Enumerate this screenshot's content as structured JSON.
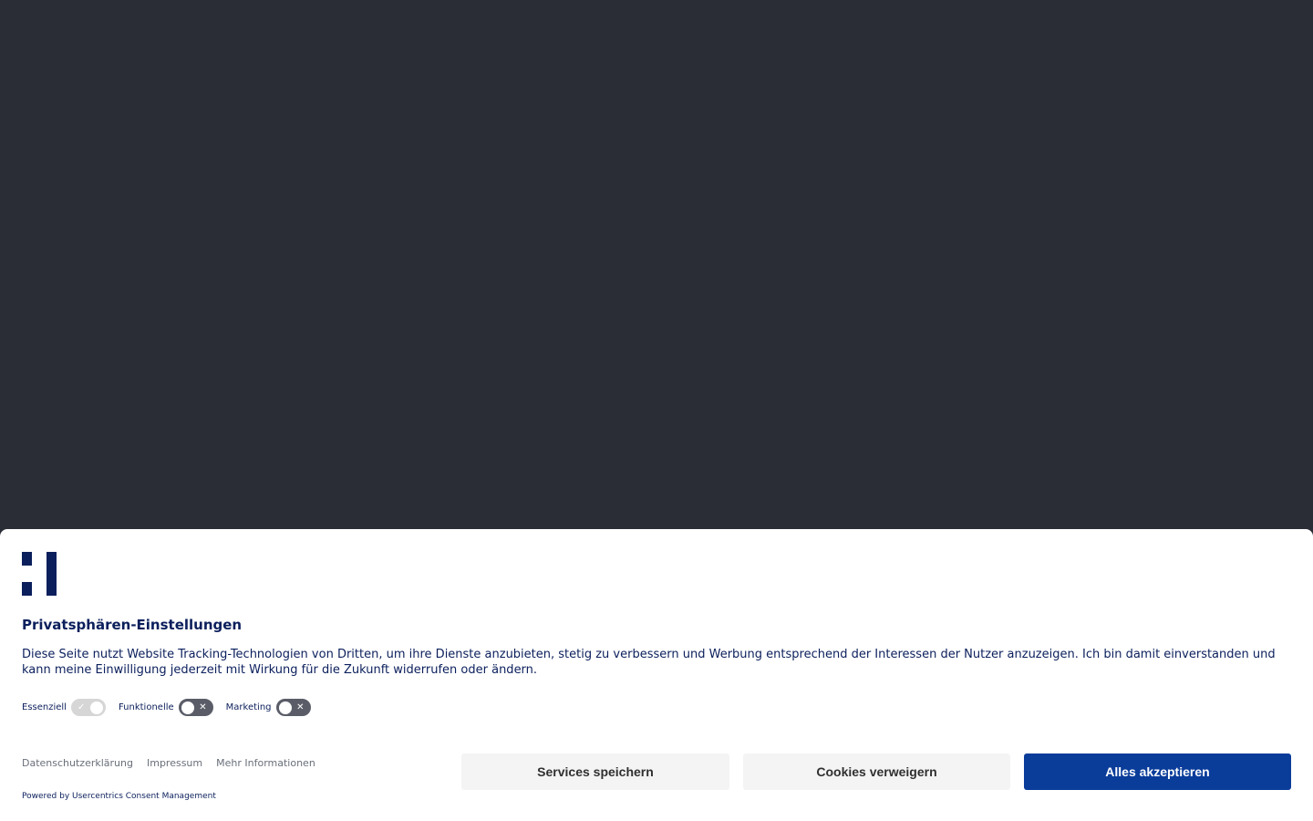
{
  "consent": {
    "title": "Privatsphären-Einstellungen",
    "description": "Diese Seite nutzt Website Tracking-Technologien von Dritten, um ihre Dienste anzubieten, stetig zu verbessern und Werbung entsprechend der Interessen der Nutzer anzuzeigen. Ich bin damit einverstanden und kann meine Einwilligung jederzeit mit Wirkung für die Zukunft widerrufen oder ändern.",
    "toggles": [
      {
        "label": "Essenziell",
        "state": "on",
        "disabled": true
      },
      {
        "label": "Funktionelle",
        "state": "off",
        "disabled": false
      },
      {
        "label": "Marketing",
        "state": "off",
        "disabled": false
      }
    ],
    "links": {
      "privacy": "Datenschutzerklärung",
      "imprint": "Impressum",
      "more_info": "Mehr Informationen"
    },
    "powered_by": "Powered by Usercentrics Consent Management",
    "buttons": {
      "save": "Services speichern",
      "deny": "Cookies verweigern",
      "accept": "Alles akzeptieren"
    }
  },
  "colors": {
    "backdrop": "#2a2c36",
    "brand_dark": "#0b1f5c",
    "accept_button": "#0a3c9a",
    "secondary_button": "#f4f4f4"
  }
}
